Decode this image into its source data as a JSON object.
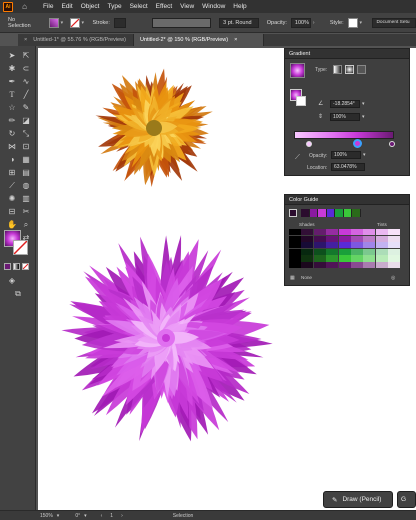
{
  "app": {
    "logo": "Ai"
  },
  "menu": [
    "File",
    "Edit",
    "Object",
    "Type",
    "Select",
    "Effect",
    "View",
    "Window",
    "Help"
  ],
  "control": {
    "selection_label": "No Selection",
    "stroke_label": "Stroke:",
    "brush": "3 pt. Round",
    "opacity_label": "Opacity:",
    "opacity_value": "100%",
    "style_label": "Style:",
    "doc_setup": "Document Setu"
  },
  "tabs": [
    {
      "label": "Untitled-1* @ 55.76 % (RGB/Preview)",
      "close": "×"
    },
    {
      "label": "Untitled-2* @ 150 % (RGB/Preview)",
      "close": "×"
    }
  ],
  "gradient_panel": {
    "title": "Gradient",
    "type_label": "Type:",
    "angle": "-18.2854°",
    "aspect": "100%",
    "opacity_label": "Opacity:",
    "opacity_value": "100%",
    "location_label": "Location:",
    "location_value": "63.0478%"
  },
  "color_guide": {
    "title": "Color Guide",
    "shades_label": "Shades",
    "tints_label": "Tints",
    "none_label": "None"
  },
  "status": {
    "zoom": "150%",
    "angle": "0°",
    "page": "1",
    "mode": "Selection"
  },
  "draw_button": {
    "label": "Draw (Pencil)",
    "extra": "G"
  },
  "colors": {
    "magenta": "#c83ad8",
    "orange": "#e8930f",
    "canvas": "#ffffff"
  }
}
